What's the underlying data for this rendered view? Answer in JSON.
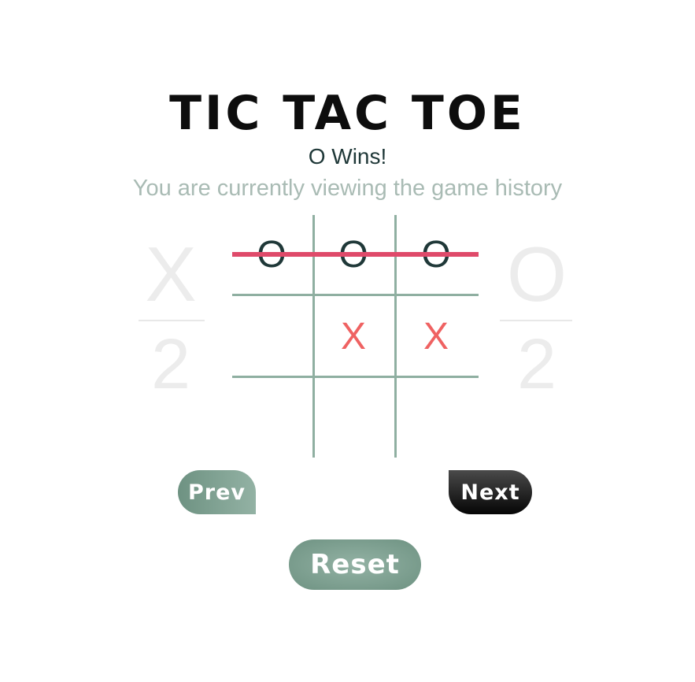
{
  "title": "TIC TAC TOE",
  "status": "O Wins!",
  "history_note": "You are currently viewing the game history",
  "scores": {
    "x": {
      "symbol": "X",
      "value": "2"
    },
    "o": {
      "symbol": "O",
      "value": "2"
    }
  },
  "board": {
    "cells": [
      "O",
      "O",
      "O",
      "",
      "X",
      "X",
      "",
      "",
      ""
    ],
    "winning_line": "top-row"
  },
  "buttons": {
    "prev": "Prev",
    "next": "Next",
    "reset": "Reset"
  },
  "colors": {
    "accent_green": "#8fafa1",
    "win_line": "#df4a6a",
    "x_mark": "#ef6262",
    "o_mark": "#1f3838"
  }
}
